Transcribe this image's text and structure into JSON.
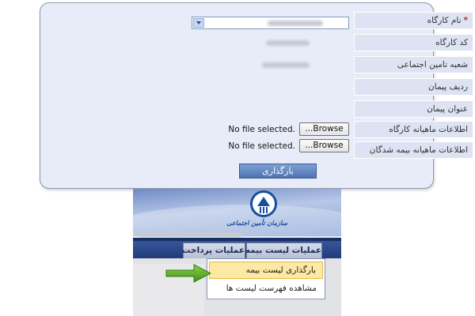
{
  "form": {
    "rows": [
      {
        "label": "نام کارگاه",
        "required": true,
        "required_mark": "*"
      },
      {
        "label": "کد کارگاه"
      },
      {
        "label": "شعبه تامین اجتماعی"
      },
      {
        "label": "ردیف پیمان"
      },
      {
        "label": "عنوان پیمان"
      },
      {
        "label": "اطلاعات ماهیانه کارگاه"
      },
      {
        "label": "اطلاعات ماهیانه بیمه شدگان"
      }
    ],
    "file_inputs": [
      {
        "browse_label": "...Browse",
        "status": "No file selected."
      },
      {
        "browse_label": "...Browse",
        "status": "No file selected."
      }
    ],
    "upload_label": "بارگذاری"
  },
  "app": {
    "logo_text": "سازمان تأمین اجتماعی",
    "menu": {
      "tabs": [
        "عملیات لیست بیمه",
        "عملیات پرداخت"
      ],
      "active_tab": "عملیات لیست بیمه"
    },
    "dropdown": {
      "items": [
        "بارگذاری لیست بیمه",
        "مشاهده فهرست لیست ها"
      ],
      "highlighted": "بارگذاری لیست بیمه"
    }
  },
  "colors": {
    "panel_bg": "#e8ecf8",
    "label_bg": "#dde3f2",
    "upload_button": "#5c80bd",
    "menu_bar": "#2d4a8c",
    "dropdown_highlight": "#fde9a4",
    "arrow": "#5aaa2a",
    "required": "#d32020"
  },
  "icons": {
    "select_arrow": "chevron-down-icon",
    "pointer": "arrow-right-icon",
    "logo": "social-security-logo-icon"
  }
}
